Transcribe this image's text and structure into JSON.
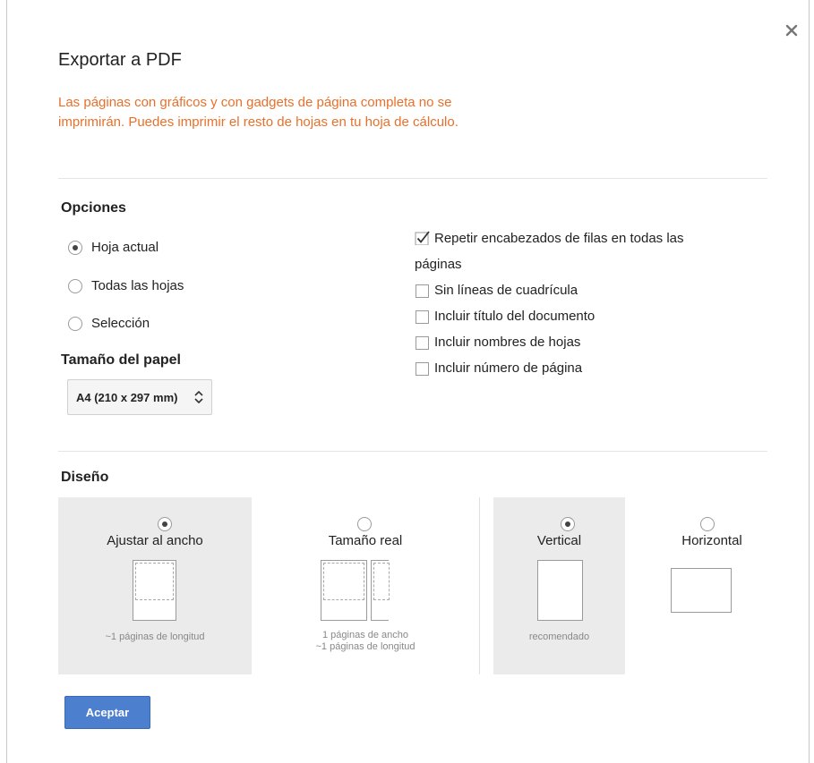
{
  "dialog": {
    "title": "Exportar a PDF",
    "warning": "Las páginas con gráficos y con gadgets de página completa no se imprimirán. Puedes imprimir el resto de hojas en tu hoja de cálculo.",
    "close_icon": "close-icon",
    "warning_color": "#e8702a"
  },
  "options": {
    "title": "Opciones",
    "scope": [
      {
        "label": "Hoja actual",
        "checked": true
      },
      {
        "label": "Todas las hojas",
        "checked": false
      },
      {
        "label": "Selección",
        "checked": false
      }
    ],
    "checkboxes": [
      {
        "label_line1": "Repetir encabezados de filas en todas las",
        "label_line2": "páginas",
        "checked": true
      },
      {
        "label_line1": "Sin líneas de cuadrícula",
        "checked": false
      },
      {
        "label_line1": "Incluir título del documento",
        "checked": false
      },
      {
        "label_line1": "Incluir nombres de hojas",
        "checked": false
      },
      {
        "label_line1": "Incluir número de página",
        "checked": false
      }
    ]
  },
  "paper": {
    "title": "Tamaño del papel",
    "selected": "A4 (210 x 297 mm)"
  },
  "layout": {
    "title": "Diseño",
    "fit": [
      {
        "label": "Ajustar al ancho",
        "sub1": "~1 páginas de longitud",
        "sub2": "",
        "checked": true
      },
      {
        "label": "Tamaño real",
        "sub1": "1 páginas de ancho",
        "sub2": "~1 páginas de longitud",
        "checked": false
      }
    ],
    "orientation": [
      {
        "label": "Vertical",
        "sub1": "recomendado",
        "checked": true
      },
      {
        "label": "Horizontal",
        "sub1": "",
        "checked": false
      }
    ]
  },
  "actions": {
    "accept_label": "Aceptar",
    "accept_color": "#4d7fcf"
  }
}
